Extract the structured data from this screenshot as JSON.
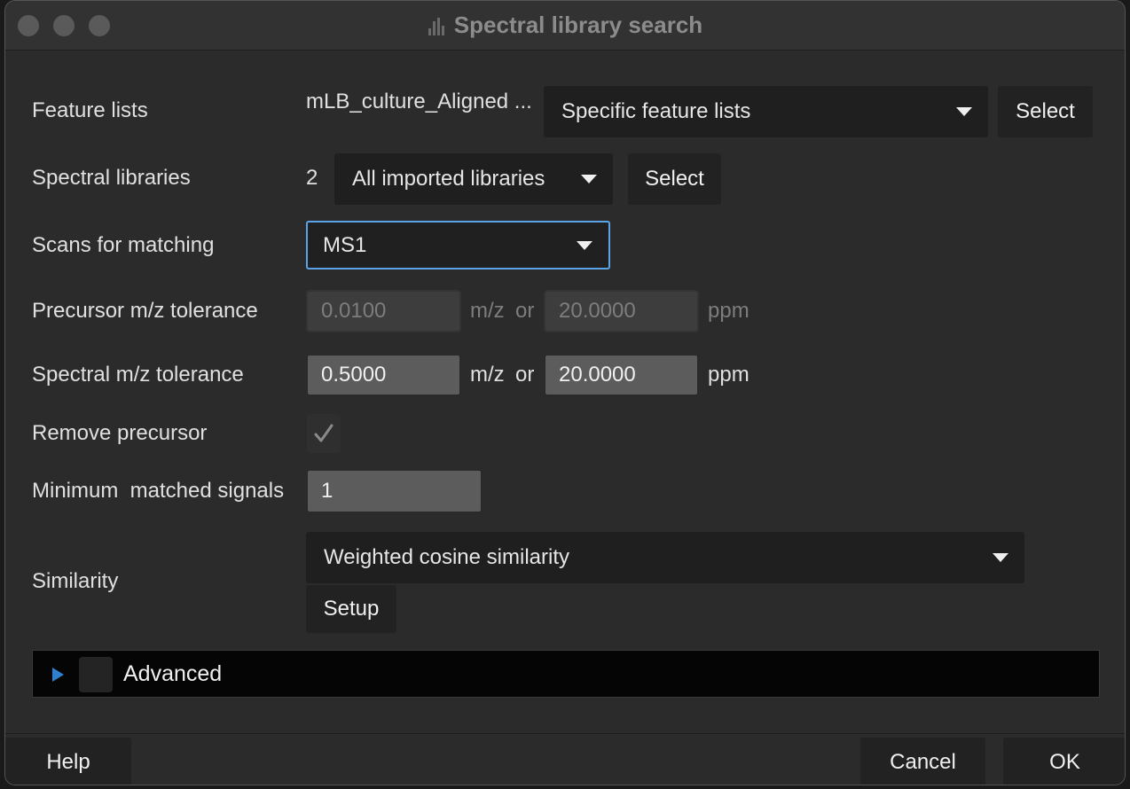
{
  "window": {
    "title": "Spectral library search",
    "title_icon": "spectrum-icon"
  },
  "feature_lists": {
    "label": "Feature lists",
    "value": "mLB_culture_Aligned ...",
    "mode": "Specific feature lists",
    "select_label": "Select"
  },
  "spectral_libraries": {
    "label": "Spectral libraries",
    "count": "2",
    "mode": "All imported libraries",
    "select_label": "Select"
  },
  "scans": {
    "label": "Scans for matching",
    "value": "MS1"
  },
  "precursor_tol": {
    "label": "Precursor m/z tolerance",
    "mz": "0.0100",
    "mz_unit": "m/z",
    "or": "or",
    "ppm": "20.0000",
    "ppm_unit": "ppm"
  },
  "spectral_tol": {
    "label": "Spectral m/z tolerance",
    "mz": "0.5000",
    "mz_unit": "m/z",
    "or": "or",
    "ppm": "20.0000",
    "ppm_unit": "ppm"
  },
  "remove_precursor": {
    "label": "Remove precursor",
    "checked": true
  },
  "min_signals": {
    "label": "Minimum  matched signals",
    "value": "1"
  },
  "similarity": {
    "label": "Similarity",
    "value": "Weighted cosine similarity",
    "setup_label": "Setup"
  },
  "advanced": {
    "label": "Advanced"
  },
  "footer": {
    "help": "Help",
    "cancel": "Cancel",
    "ok": "OK"
  },
  "colors": {
    "focus_border": "#5aa3e6",
    "expander_arrow": "#2f7fd0"
  }
}
